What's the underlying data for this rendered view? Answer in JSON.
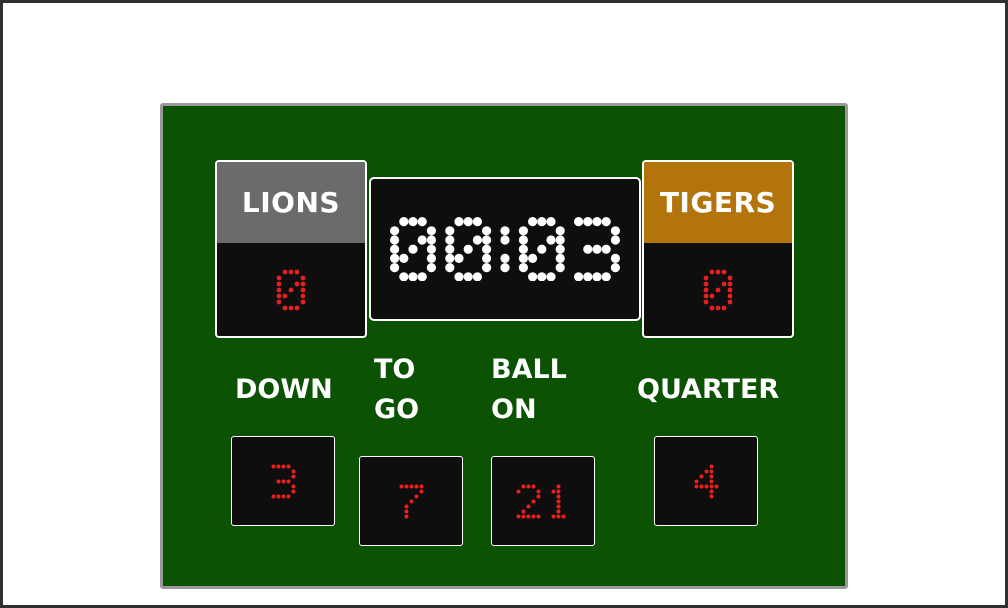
{
  "home": {
    "name": "LIONS",
    "score": "0",
    "name_bg": "#6b6b6b"
  },
  "away": {
    "name": "TIGERS",
    "score": "0",
    "name_bg": "#b3740c"
  },
  "clock": {
    "value": "00:03"
  },
  "stats": {
    "down": {
      "label": "DOWN",
      "value": "3"
    },
    "to_go": {
      "label": "TO\nGO",
      "value": "7"
    },
    "ball_on": {
      "label": "BALL\nON",
      "value": "21"
    },
    "quarter": {
      "label": "QUARTER",
      "value": "4"
    }
  },
  "colors": {
    "board": "#0b5202",
    "panel": "#0e0e0e",
    "score_digits": "#e8201e",
    "clock_digits": "#ffffff"
  }
}
